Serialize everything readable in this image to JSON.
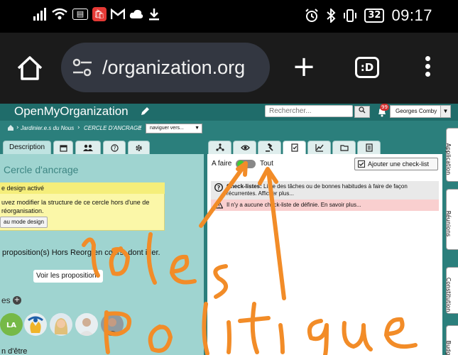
{
  "status_bar": {
    "time": "09:17",
    "battery": "32",
    "left_icons": [
      "signal-icon",
      "wifi-icon",
      "news-icon",
      "shopping-icon",
      "gmail-icon",
      "cloud-icon",
      "download-icon"
    ],
    "right_icons": [
      "alarm-icon",
      "bluetooth-icon",
      "vibrate-icon",
      "battery-icon"
    ]
  },
  "browser": {
    "url": "/organization.org",
    "tabs_label": ":D"
  },
  "app": {
    "brand": "OpenMyOrganization",
    "search_placeholder": "Rechercher...",
    "notification_count": "99",
    "user": "Georges Comby",
    "breadcrumb": [
      "Jardinier.e.s du Nous",
      "CERCLE D'ANCRAGE"
    ],
    "nav_select": "naviguer vers...",
    "colors": {
      "header": "#1f6c6a",
      "background": "#2b7f7c",
      "panel": "#9fd4d0",
      "accent_green": "#3ec935"
    }
  },
  "left_panel": {
    "active_tab": "Description",
    "tab_icons": [
      "calendar-icon",
      "group-icon",
      "help-icon",
      "gear-icon"
    ],
    "title": "Cercle d'ancrage",
    "notice_title": "e design activé",
    "notice_body": "uvez modifier la structure de ce cercle hors d'une de réorganisation.",
    "notice_button": "au mode design",
    "proposals_text": "proposition(s) Hors Reorg en cours, dont ider.",
    "proposals_button": "Voir les propositions",
    "members_label": "es",
    "members_add": "+",
    "raison": "n d'être"
  },
  "right_panel": {
    "tab_icons": [
      "wheel-icon",
      "eye-icon",
      "gavel-icon",
      "checklist-icon",
      "chart-icon",
      "folder-icon",
      "notes-icon"
    ],
    "afaire_label": "A faire",
    "tout_label": "Tout",
    "add_button": "Ajouter une check-list",
    "info_title": "Check-listes:",
    "info_text": " Liste des tâches ou de bonnes habitudes à faire de façon récurrentes. Afficher plus...",
    "warn_text": "Il n'y a aucune check-liste de définie. En savoir plus..."
  },
  "side_tabs": [
    "Application",
    "Réunions",
    "Constitution",
    "Budget"
  ],
  "handwriting": [
    "role",
    "politique"
  ]
}
